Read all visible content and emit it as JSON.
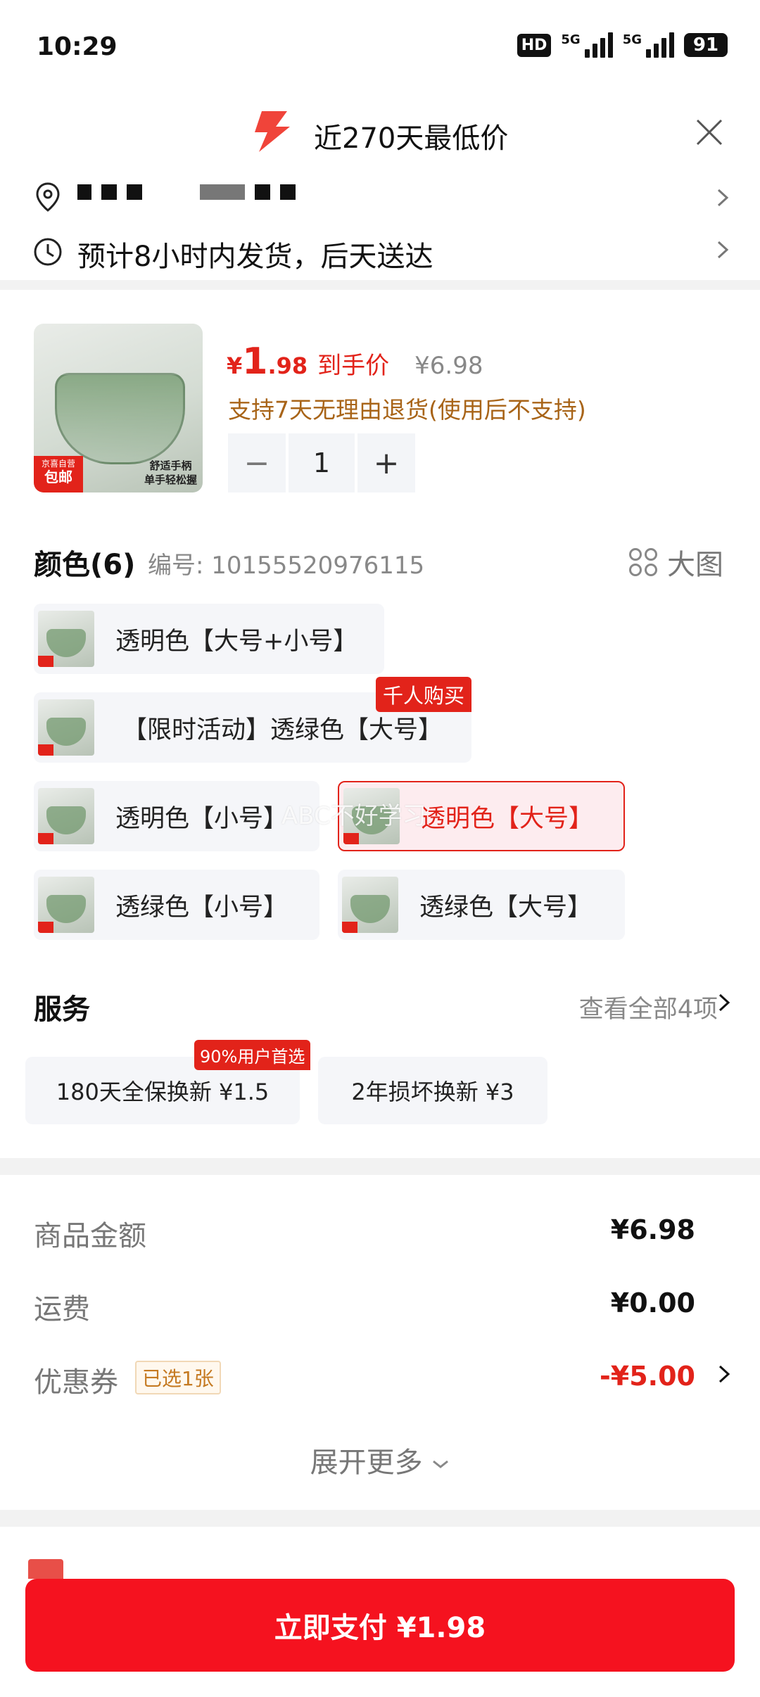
{
  "status_bar": {
    "time": "10:29",
    "hd": "HD",
    "net_1": "5G",
    "net_2": "5G",
    "battery": "91"
  },
  "header": {
    "banner": "近270天最低价"
  },
  "address": {
    "masked": true
  },
  "delivery": {
    "text": "预计8小时内发货，后天送达"
  },
  "product": {
    "thumb_tag_top": "京喜自营",
    "thumb_tag_bottom": "包邮",
    "thumb_caption_1": "舒适手柄",
    "thumb_caption_2": "单手轻松握",
    "currency": "¥",
    "price_int": "1",
    "price_dec": ".98",
    "price_suffix": "到手价",
    "orig_price": "¥6.98",
    "return_policy": "支持7天无理由退货(使用后不支持)",
    "qty_minus": "−",
    "qty": "1",
    "qty_plus": "+"
  },
  "colors": {
    "title": "颜色(6)",
    "code": "编号: 10155520976115",
    "big_image": "大图",
    "options": [
      {
        "label": "透明色【大号+小号】"
      },
      {
        "label": "【限时活动】透绿色【大号】",
        "badge": "千人购买"
      },
      {
        "label": "透明色【小号】"
      },
      {
        "label": "透明色【大号】",
        "selected": true
      },
      {
        "label": "透绿色【小号】"
      },
      {
        "label": "透绿色【大号】"
      }
    ],
    "watermark": "ABC不好学习"
  },
  "services": {
    "title": "服务",
    "view_all": "查看全部4项",
    "items": [
      {
        "label": "180天全保换新 ¥1.5",
        "badge": "90%用户首选"
      },
      {
        "label": "2年损坏换新 ¥3"
      }
    ]
  },
  "summary": {
    "goods_label": "商品金额",
    "goods_value": "¥6.98",
    "shipping_label": "运费",
    "shipping_value": "¥0.00",
    "coupon_label": "优惠券",
    "coupon_tag": "已选1张",
    "coupon_value": "-¥5.00",
    "expand": "展开更多",
    "accent_color": "#e2231a"
  },
  "pay": {
    "label": "立即支付 ¥1.98"
  }
}
